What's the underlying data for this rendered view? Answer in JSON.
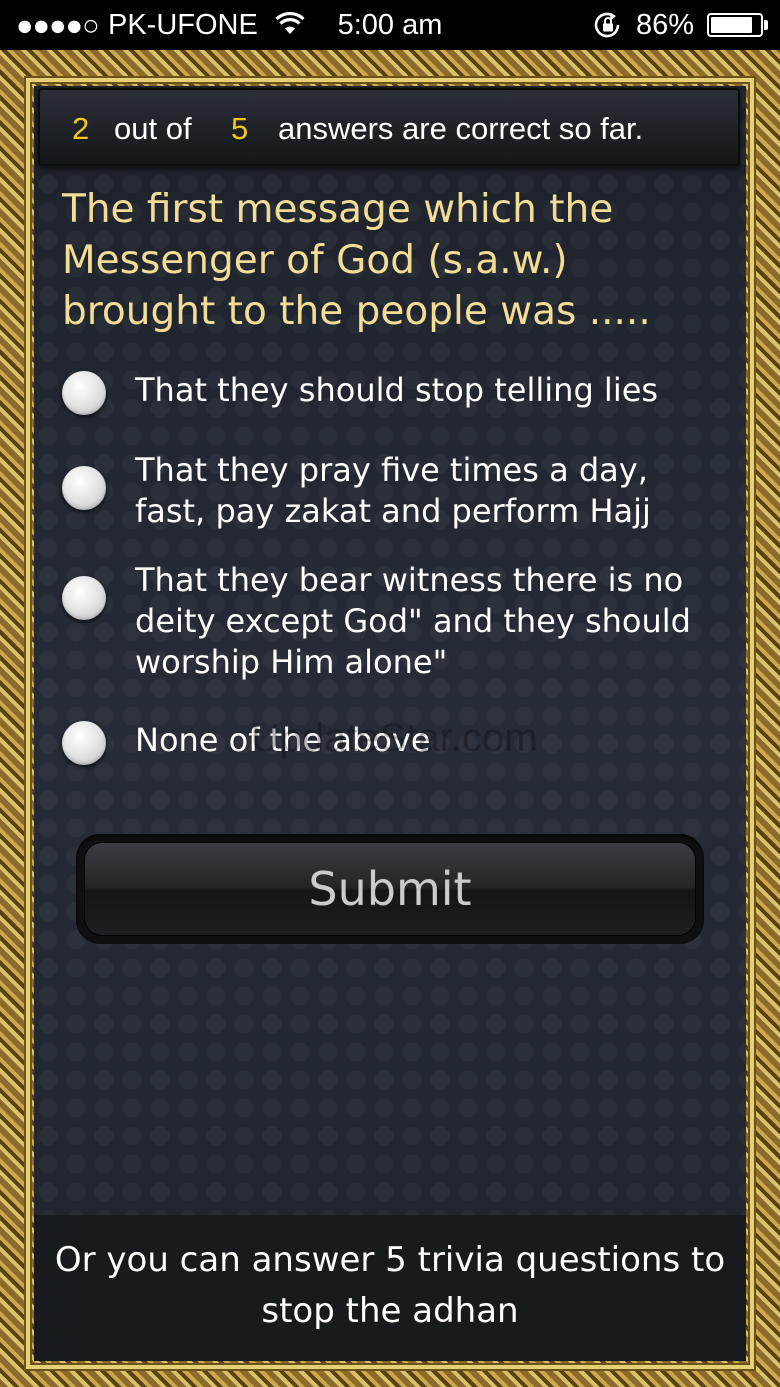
{
  "status_bar": {
    "signal": "●●●●○",
    "carrier": "PK-UFONE",
    "time": "5:00 am",
    "battery_percent": "86%",
    "battery_level": 0.86
  },
  "score": {
    "correct": "2",
    "out_of_label": "out of",
    "total": "5",
    "suffix": "answers are correct so far."
  },
  "question": "The first message which the Messenger of God (s.a.w.) brought to the people was .....",
  "options": [
    {
      "label": "That they should stop telling lies"
    },
    {
      "label": "That they pray five times a day, fast, pay zakat and perform Hajj"
    },
    {
      "label": "That they bear witness there is no deity except God\" and they should worship Him alone\""
    },
    {
      "label": "None of the above"
    }
  ],
  "watermark": "UpdateStar.com",
  "submit_label": "Submit",
  "footer_text": "Or you can answer 5 trivia questions to stop the adhan",
  "icons": {
    "wifi": "wifi-icon",
    "rotation_lock": "rotation-lock-icon",
    "battery": "battery-icon"
  }
}
